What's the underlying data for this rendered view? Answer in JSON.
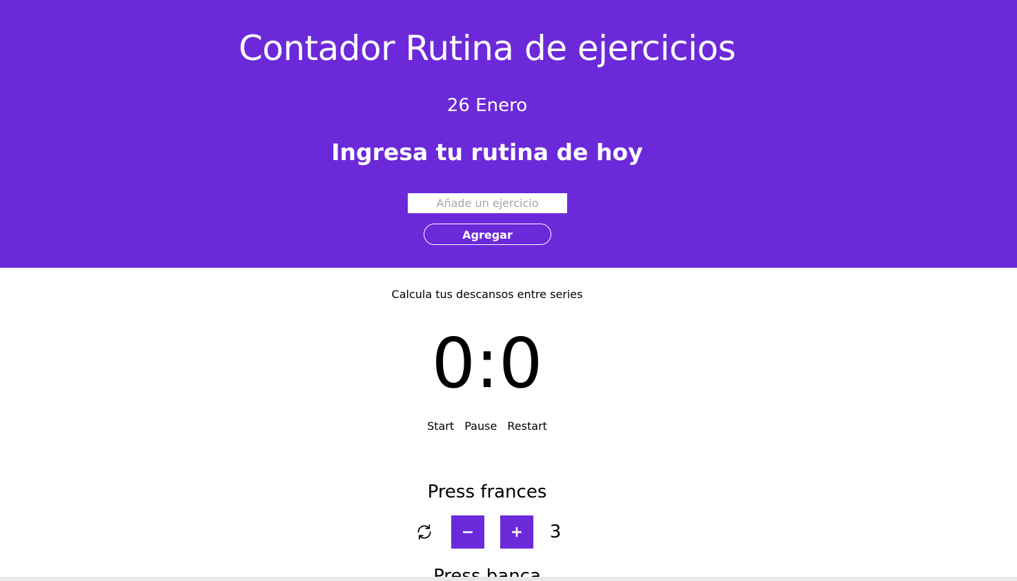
{
  "header": {
    "title": "Contador Rutina de ejercicios",
    "date": "26 Enero",
    "subtitle": "Ingresa tu rutina de hoy",
    "exercise_input": {
      "placeholder": "Añade un ejercicio",
      "value": ""
    },
    "add_button": "Agregar",
    "accent_color": "#6c29d9"
  },
  "timer": {
    "label": "Calcula tus descansos entre series",
    "display": "0:0",
    "controls": {
      "start": "Start",
      "pause": "Pause",
      "restart": "Restart"
    }
  },
  "exercises": [
    {
      "name": "Press frances",
      "icon": "refresh-icon",
      "minus_label": "−",
      "plus_label": "+",
      "count": "3"
    },
    {
      "name": "Press banca"
    }
  ]
}
